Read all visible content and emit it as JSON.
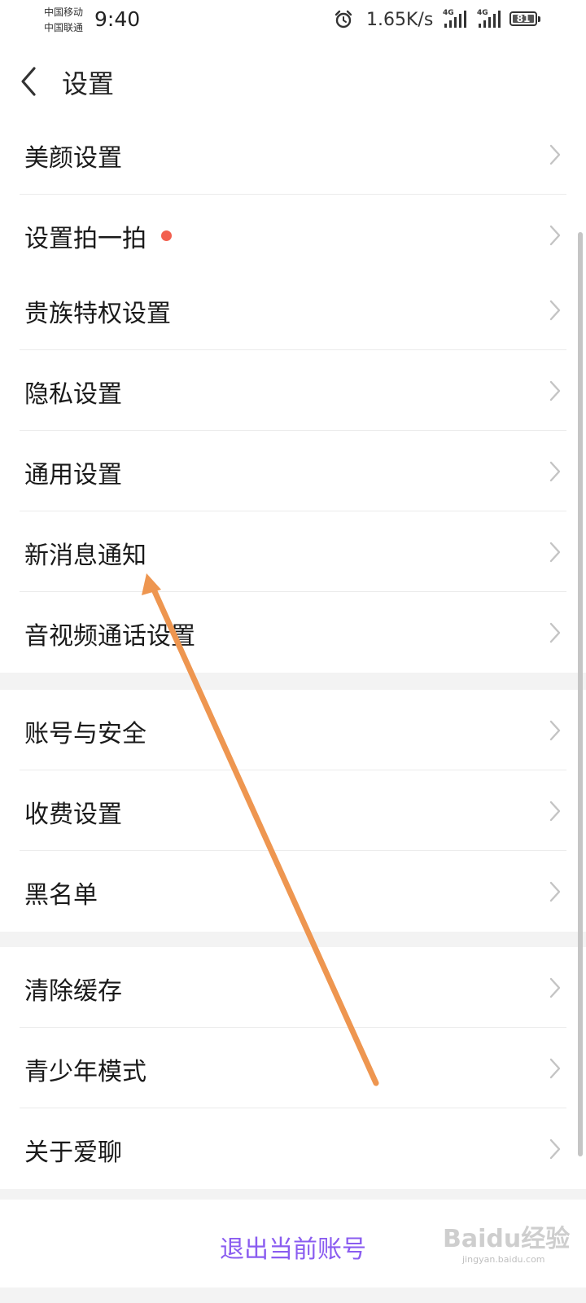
{
  "status_bar": {
    "carrier_1": "中国移动",
    "carrier_2": "中国联通",
    "time": "9:40",
    "net_speed": "1.65K/s",
    "signal_1_label": "4G",
    "signal_2_label": "4G",
    "battery": "81"
  },
  "header": {
    "title": "设置"
  },
  "groups": [
    {
      "items": [
        {
          "label": "美颜设置"
        },
        {
          "label": "设置拍一拍"
        }
      ]
    },
    {
      "items": [
        {
          "label": "贵族特权设置"
        },
        {
          "label": "隐私设置"
        },
        {
          "label": "通用设置"
        },
        {
          "label": "新消息通知"
        },
        {
          "label": "音视频通话设置"
        }
      ]
    },
    {
      "items": [
        {
          "label": "账号与安全"
        },
        {
          "label": "收费设置"
        },
        {
          "label": "黑名单"
        }
      ]
    },
    {
      "items": [
        {
          "label": "清除缓存"
        },
        {
          "label": "青少年模式"
        },
        {
          "label": "关于爱聊"
        }
      ]
    }
  ],
  "logout_label": "退出当前账号",
  "watermark": {
    "main": "Baidu经验",
    "sub": "jingyan.baidu.com"
  },
  "colors": {
    "accent_purple": "#8a5cf0",
    "badge_red": "#f2604f",
    "annotation_arrow": "#ee9650",
    "chevron": "#c4c4c4"
  },
  "icons": {
    "back": "back-chevron-icon",
    "row_chevron": "chevron-right-icon",
    "alarm": "alarm-clock-icon"
  }
}
